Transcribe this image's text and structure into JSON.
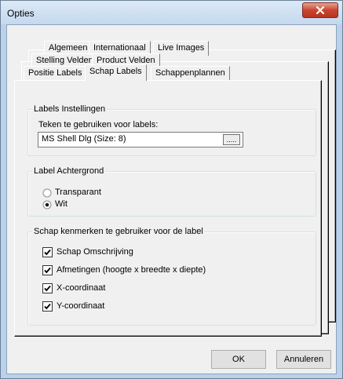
{
  "window": {
    "title": "Opties",
    "close_icon": "close-icon"
  },
  "tabs": {
    "row1": [
      "Algemeen",
      "Internationaal",
      "Live Images"
    ],
    "row2": [
      "Stelling Velden",
      "Product Velden"
    ],
    "row3": [
      "Positie Labels",
      "Schap Labels",
      "Schappenplannen"
    ],
    "active": "Schap Labels"
  },
  "labels_settings": {
    "legend": "Labels Instellingen",
    "font_label": "Teken te gebruiken voor labels:",
    "font_value": "MS Shell Dlg (Size: 8)",
    "browse_label": "....."
  },
  "label_background": {
    "legend": "Label Achtergrond",
    "options": [
      {
        "label": "Transparant",
        "selected": false
      },
      {
        "label": "Wit",
        "selected": true
      }
    ]
  },
  "shelf_features": {
    "legend": "Schap kenmerken te gebruiker voor de label",
    "items": [
      {
        "label": "Schap Omschrijving",
        "checked": true
      },
      {
        "label": "Afmetingen (hoogte x breedte x diepte)",
        "checked": true
      },
      {
        "label": "X-coordinaat",
        "checked": true
      },
      {
        "label": "Y-coordinaat",
        "checked": true
      }
    ]
  },
  "footer": {
    "ok_label": "OK",
    "cancel_label": "Annuleren"
  }
}
